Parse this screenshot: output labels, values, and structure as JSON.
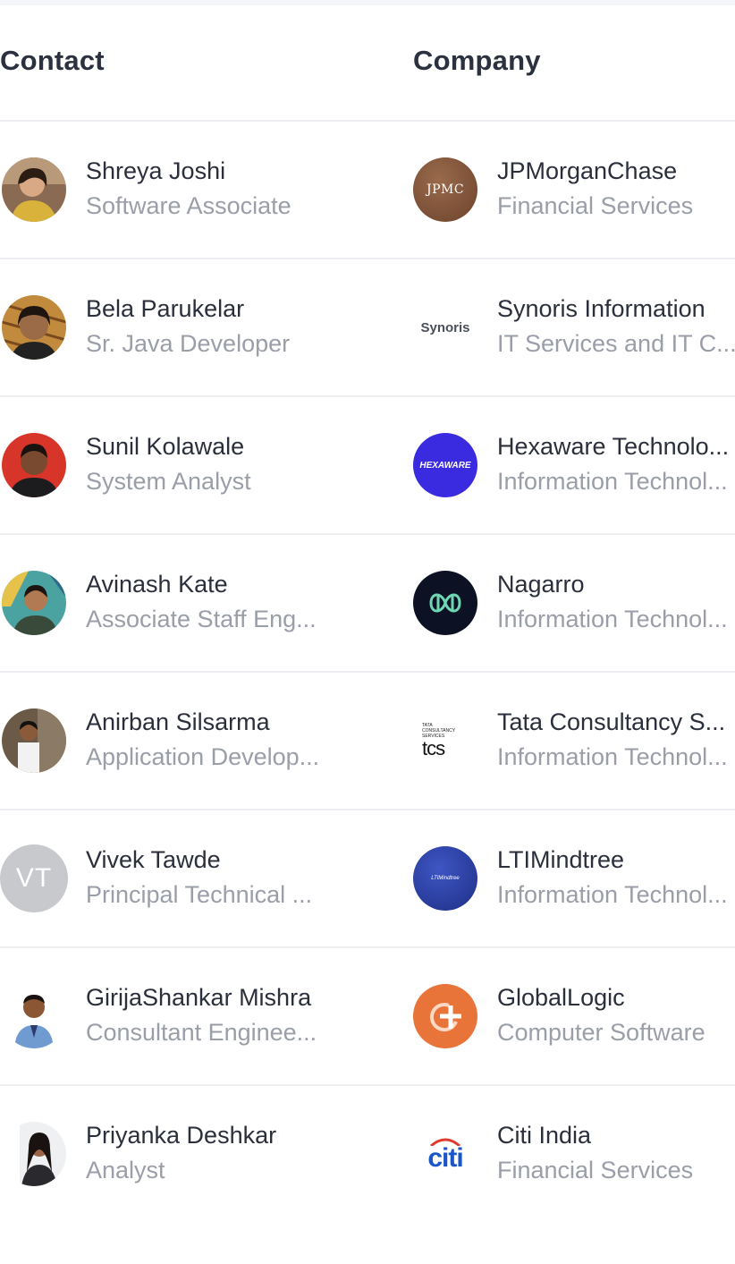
{
  "table": {
    "headers": {
      "contact": "Contact",
      "company": "Company"
    },
    "rows": [
      {
        "contact": {
          "name": "Shreya Joshi",
          "title": "Software Associate",
          "avatar": "photo"
        },
        "company": {
          "name": "JPMorganChase",
          "industry": "Financial Services",
          "logo_text": "JPMC"
        }
      },
      {
        "contact": {
          "name": "Bela Parukelar",
          "title": "Sr. Java Developer",
          "avatar": "photo"
        },
        "company": {
          "name": "Synoris Information",
          "industry": "IT Services and IT C...",
          "logo_text": "Synoris"
        }
      },
      {
        "contact": {
          "name": "Sunil Kolawale",
          "title": "System Analyst",
          "avatar": "photo"
        },
        "company": {
          "name": "Hexaware Technolo...",
          "industry": "Information Technol...",
          "logo_text": "HEXAWARE"
        }
      },
      {
        "contact": {
          "name": "Avinash Kate",
          "title": "Associate Staff Eng...",
          "avatar": "photo"
        },
        "company": {
          "name": "Nagarro",
          "industry": "Information Technol...",
          "logo_text": ""
        }
      },
      {
        "contact": {
          "name": "Anirban Silsarma",
          "title": "Application Develop...",
          "avatar": "photo"
        },
        "company": {
          "name": "Tata Consultancy S...",
          "industry": "Information Technol...",
          "logo_text": "TATA CONSULTANCY SERVICES",
          "logo_mark": "tcs"
        }
      },
      {
        "contact": {
          "name": "Vivek Tawde",
          "title": "Principal Technical ...",
          "initials": "VT"
        },
        "company": {
          "name": "LTIMindtree",
          "industry": "Information Technol...",
          "logo_text": "LTIMindtree"
        }
      },
      {
        "contact": {
          "name": "GirijaShankar Mishra",
          "title": "Consultant Enginee...",
          "avatar": "photo"
        },
        "company": {
          "name": "GlobalLogic",
          "industry": "Computer Software",
          "logo_text": ""
        }
      },
      {
        "contact": {
          "name": "Priyanka Deshkar",
          "title": "Analyst",
          "avatar": "photo"
        },
        "company": {
          "name": "Citi India",
          "industry": "Financial Services",
          "logo_text": "citi"
        }
      }
    ]
  },
  "colors": {
    "header_text": "#2c3140",
    "primary_text": "#2a2f3b",
    "secondary_text": "#9a9ea8",
    "divider": "#eceef2",
    "hexaware": "#3a2be0",
    "nagarro": "#0c1224",
    "ltimindtree": "#2b3f9e",
    "globallogic": "#e8743a",
    "citi_blue": "#1a56c9",
    "citi_red": "#e03a2f"
  }
}
